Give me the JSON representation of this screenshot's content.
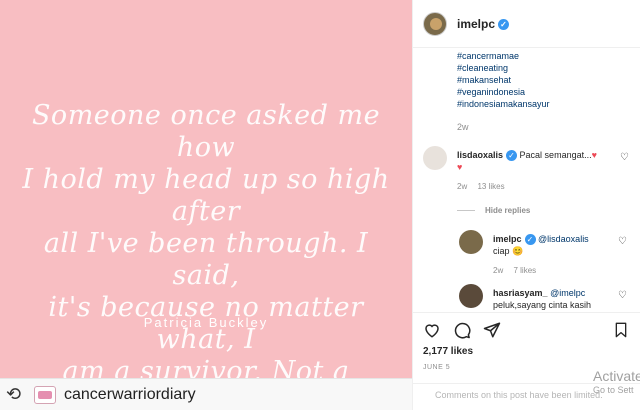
{
  "post": {
    "quote_lines": [
      "Someone once asked me how",
      "I hold my head up so high after",
      "all I've been through. I said,",
      "it's because no matter what, I",
      "am a survivor. Not a victim."
    ],
    "author": "Patricia Buckley",
    "repost_user": "cancerwarriordiary"
  },
  "header": {
    "username": "imelpc"
  },
  "caption": {
    "tags": [
      "#cancermamae",
      "#cleaneating",
      "#makansehat",
      "#veganindonesia",
      "#indonesiamakansayur"
    ],
    "time": "2w"
  },
  "comments": [
    {
      "user": "lisdaoxalis",
      "text": "Pacal semangat...",
      "time": "2w",
      "likes": "13 likes"
    }
  ],
  "hide_replies": "Hide replies",
  "replies": [
    {
      "user": "imelpc",
      "mention": "@lisdaoxalis",
      "text": "ciap",
      "time": "2w",
      "likes": "7 likes"
    },
    {
      "user": "hasriasyam_",
      "mention": "@imelpc",
      "text": "peluk,sayang cinta kasih"
    }
  ],
  "likes_count": "2,177 likes",
  "date": "JUNE 5",
  "comments_limited": "Comments on this post have been limited.",
  "watermark": {
    "line1": "Activate",
    "line2": "Go to Sett"
  },
  "colors": {
    "image_bg": "#f8bec2",
    "link": "#00376b",
    "verified": "#3897f0",
    "heart": "#ed4956"
  }
}
